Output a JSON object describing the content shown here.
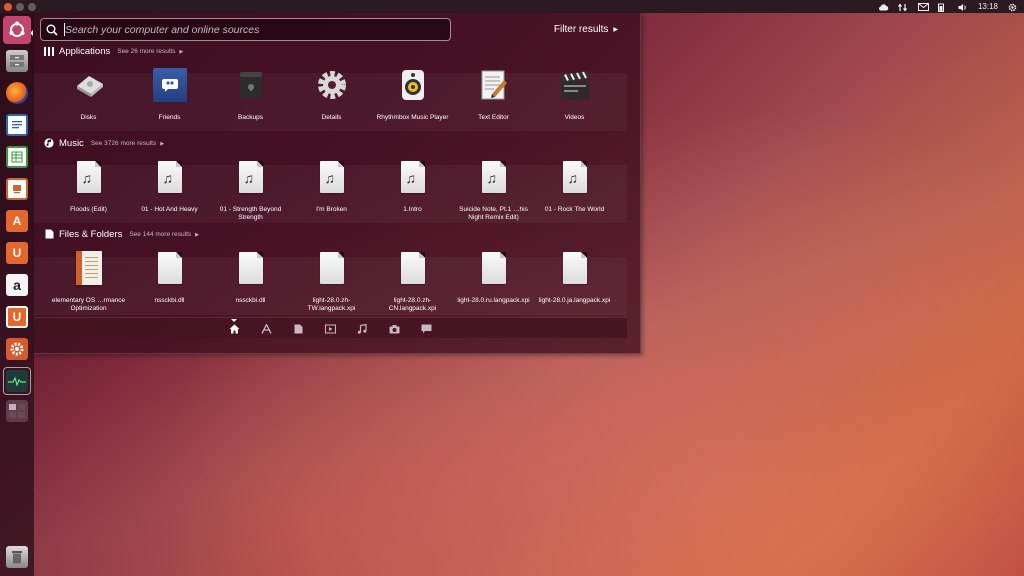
{
  "topbar": {
    "time": "13:18"
  },
  "launcher": {
    "items": [
      {
        "name": "dash-home",
        "label": ""
      },
      {
        "name": "files",
        "label": ""
      },
      {
        "name": "firefox",
        "label": ""
      },
      {
        "name": "writer",
        "label": ""
      },
      {
        "name": "calc",
        "label": ""
      },
      {
        "name": "impress",
        "label": ""
      },
      {
        "name": "software-center",
        "label": "A"
      },
      {
        "name": "ubuntu-one",
        "label": "U"
      },
      {
        "name": "amazon",
        "label": "a"
      },
      {
        "name": "ubuntu-one-music",
        "label": "U"
      },
      {
        "name": "system-settings",
        "label": ""
      },
      {
        "name": "system-monitor",
        "label": ""
      },
      {
        "name": "workspace-switcher",
        "label": ""
      },
      {
        "name": "trash",
        "label": ""
      }
    ]
  },
  "dash": {
    "search_placeholder": "Search your computer and online sources",
    "filter_label": "Filter results",
    "sections": {
      "applications": {
        "title": "Applications",
        "more": "See 26 more results",
        "items": [
          "Disks",
          "Friends",
          "Backups",
          "Details",
          "Rhythmbox Music Player",
          "Text Editor",
          "Videos"
        ]
      },
      "music": {
        "title": "Music",
        "more": "See 3726 more results",
        "items": [
          "Floods (Edit)",
          "01 - Hot And Heavy",
          "01 - Strength Beyond Strength",
          "I'm Broken",
          "1.Intro",
          "Suicide Note, Pt.1 …his Night Remix Edit)",
          "01 - Rock The World"
        ]
      },
      "files": {
        "title": "Files & Folders",
        "more": "See 144 more results",
        "items": [
          "elementary OS …rmance Optimization",
          "nssckbi.dll",
          "nssckbi.dll",
          "light-28.0.zh-TW.langpack.xpi",
          "light-28.0.zh-CN.langpack.xpi",
          "light-28.0.ru.langpack.xpi",
          "light-28.0.ja.langpack.xpi"
        ]
      }
    },
    "tabs": [
      "home",
      "applications",
      "files",
      "video",
      "music",
      "photos",
      "social"
    ]
  },
  "colors": {
    "accent": "#dd4814",
    "panel": "#2c1a22"
  }
}
